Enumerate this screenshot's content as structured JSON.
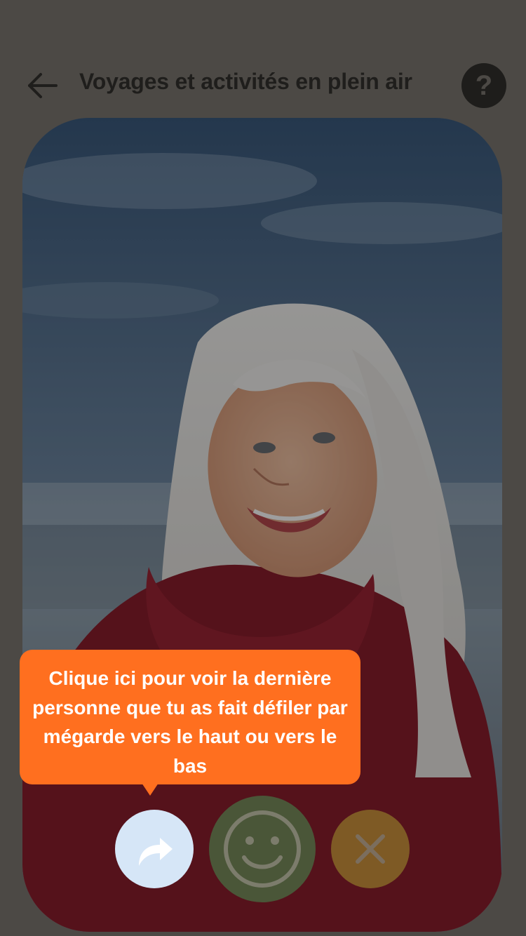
{
  "header": {
    "title": "Voyages et activités en plein air",
    "back_icon": "arrow-left-icon",
    "help_label": "?"
  },
  "profile": {
    "photo_description": "profile-photo"
  },
  "tooltip": {
    "text": "Clique ici pour voir la dernière personne que tu as fait défiler par mégarde vers le haut ou vers le bas"
  },
  "actions": {
    "rewind_icon": "rewind-arrow-icon",
    "like_icon": "smiley-icon",
    "nope_icon": "close-icon"
  },
  "colors": {
    "tooltip": "#ff6f1f",
    "rewind_button": "#d6e6f7",
    "like_button": "#4a5638",
    "nope_button": "#7e5a25",
    "help_button": "#1e1d1b"
  }
}
